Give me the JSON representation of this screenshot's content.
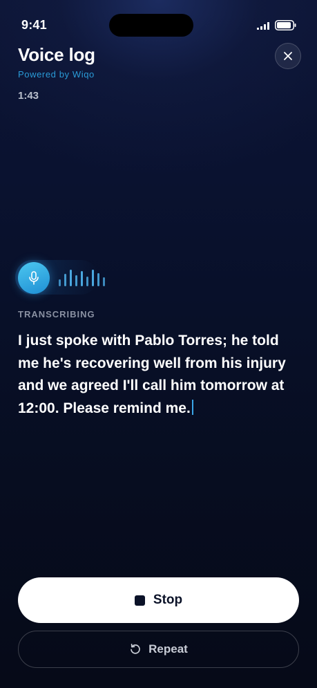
{
  "status_bar": {
    "time": "9:41"
  },
  "header": {
    "title": "Voice log",
    "powered_by": "Powered by Wiqo",
    "elapsed": "1:43",
    "close_icon": "close-icon"
  },
  "recorder": {
    "mic_icon": "microphone-icon",
    "state_label": "TRANSCRIBING",
    "transcript": "I just spoke with Pablo Torres; he told me he's recovering well from his injury and we agreed I'll call him tomorrow at 12:00. Please remind me."
  },
  "actions": {
    "stop_label": "Stop",
    "stop_icon": "stop-icon",
    "repeat_label": "Repeat",
    "repeat_icon": "repeat-icon"
  },
  "colors": {
    "accent": "#2a9bd8",
    "background": "#060b1a",
    "primary_button": "#ffffff"
  }
}
